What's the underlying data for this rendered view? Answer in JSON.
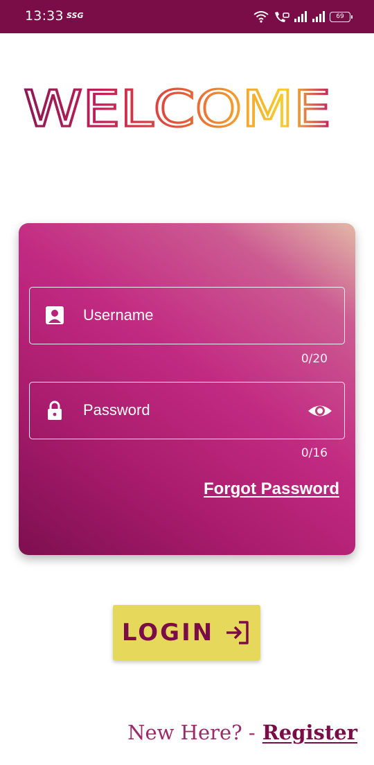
{
  "status_bar": {
    "time": "13:33",
    "carrier": "SSG",
    "battery": "69"
  },
  "header": {
    "title": "WELCOME",
    "gradient_colors": [
      "#8b1a55",
      "#c21e56",
      "#e5533a",
      "#f29a2e",
      "#f7cf2e",
      "#c0205f"
    ]
  },
  "login_form": {
    "username": {
      "placeholder": "Username",
      "value": "",
      "counter": "0/20",
      "icon": "account-box-icon"
    },
    "password": {
      "placeholder": "Password",
      "value": "",
      "counter": "0/16",
      "icon": "lock-icon",
      "toggle_icon": "eye-icon"
    },
    "forgot_password": "Forgot Password"
  },
  "login_button": {
    "label": "LOGIN",
    "icon": "login-arrow-icon"
  },
  "register": {
    "prompt": "New Here? -",
    "link": "Register"
  },
  "colors": {
    "brand": "#7a0c47",
    "card_accent": "#c22a82",
    "button": "#e6d85a"
  }
}
